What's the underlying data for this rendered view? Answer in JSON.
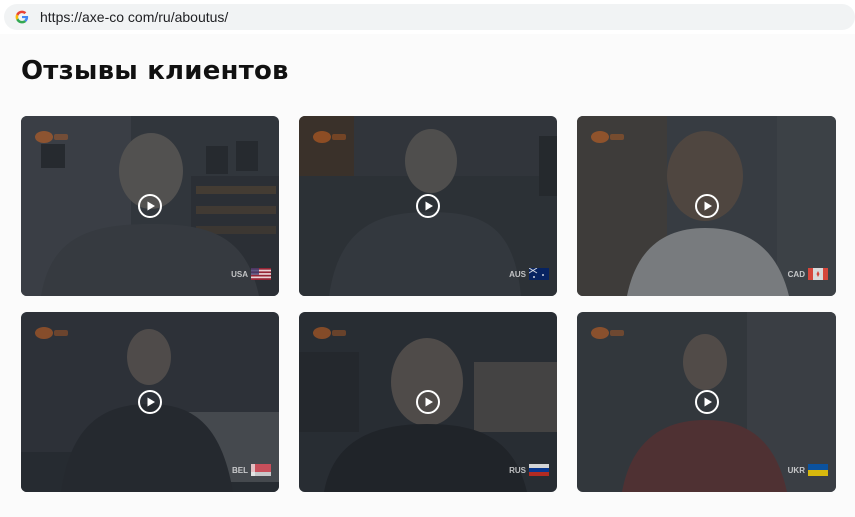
{
  "browser": {
    "url": "https://axe-co com/ru/aboutus/",
    "site_icon": "google-g-icon"
  },
  "page": {
    "title": "Отзывы клиентов"
  },
  "testimonials": [
    {
      "country": "USA",
      "flag_icon": "usa-flag-icon",
      "thumb_bg": "#3d4147"
    },
    {
      "country": "AUS",
      "flag_icon": "aus-flag-icon",
      "thumb_bg": "#3c4046"
    },
    {
      "country": "CAD",
      "flag_icon": "canada-flag-icon",
      "thumb_bg": "#464a50"
    },
    {
      "country": "BEL",
      "flag_icon": "bel-flag-icon",
      "thumb_bg": "#363a41"
    },
    {
      "country": "RUS",
      "flag_icon": "russia-flag-icon",
      "thumb_bg": "#2f333a"
    },
    {
      "country": "UKR",
      "flag_icon": "ukraine-flag-icon",
      "thumb_bg": "#3e4248"
    }
  ],
  "colors": {
    "overlay": "#1e2128",
    "play_icon": "#ffffff",
    "accent_logo": "#e0691e"
  }
}
